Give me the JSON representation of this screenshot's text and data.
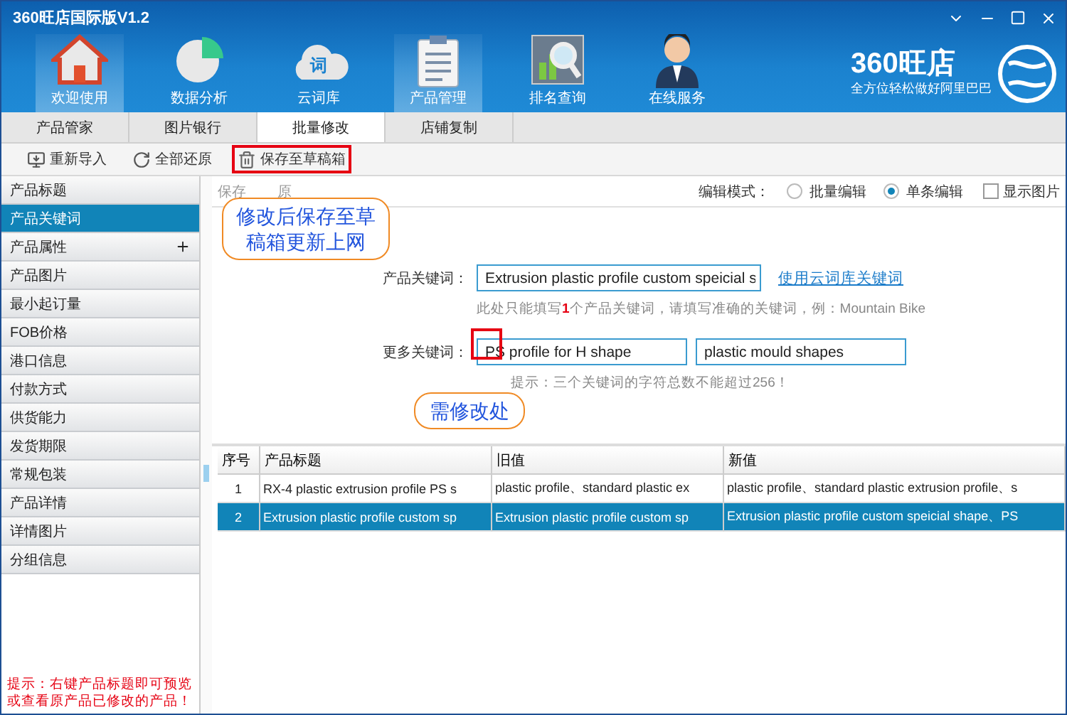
{
  "window": {
    "title": "360旺店国际版V1.2"
  },
  "nav": [
    {
      "label": "欢迎使用",
      "selected": true
    },
    {
      "label": "数据分析",
      "selected": false
    },
    {
      "label": "云词库",
      "badge": "词",
      "selected": false
    },
    {
      "label": "产品管理",
      "selected": true
    },
    {
      "label": "排名查询",
      "selected": false
    },
    {
      "label": "在线服务",
      "selected": false
    }
  ],
  "logo": {
    "name": "360旺店",
    "slogan": "全方位轻松做好阿里巴巴"
  },
  "subtabs": [
    {
      "label": "产品管家",
      "selected": false
    },
    {
      "label": "图片银行",
      "selected": false
    },
    {
      "label": "批量修改",
      "selected": true
    },
    {
      "label": "店铺复制",
      "selected": false
    }
  ],
  "toolbar": [
    {
      "label": "重新导入",
      "highlighted": false
    },
    {
      "label": "全部还原",
      "highlighted": false
    },
    {
      "label": "保存至草稿箱",
      "highlighted": true
    }
  ],
  "sidebar": {
    "items": [
      {
        "label": "产品标题",
        "selected": false,
        "expandable": false
      },
      {
        "label": "产品关键词",
        "selected": true,
        "expandable": false
      },
      {
        "label": "产品属性",
        "selected": false,
        "expandable": true
      },
      {
        "label": "产品图片",
        "selected": false,
        "expandable": false
      },
      {
        "label": "最小起订量",
        "selected": false,
        "expandable": false
      },
      {
        "label": "FOB价格",
        "selected": false,
        "expandable": false
      },
      {
        "label": "港口信息",
        "selected": false,
        "expandable": false
      },
      {
        "label": "付款方式",
        "selected": false,
        "expandable": false
      },
      {
        "label": "供货能力",
        "selected": false,
        "expandable": false
      },
      {
        "label": "发货期限",
        "selected": false,
        "expandable": false
      },
      {
        "label": "常规包装",
        "selected": false,
        "expandable": false
      },
      {
        "label": "产品详情",
        "selected": false,
        "expandable": false
      },
      {
        "label": "详情图片",
        "selected": false,
        "expandable": false
      },
      {
        "label": "分组信息",
        "selected": false,
        "expandable": false
      }
    ],
    "tip": "提示：右键产品标题即可预览或查看原产品已修改的产品！"
  },
  "actions": [
    "保存",
    "原"
  ],
  "edit_mode": {
    "label": "编辑模式：",
    "options": [
      {
        "label": "批量编辑",
        "selected": false
      },
      {
        "label": "单条编辑",
        "selected": true
      }
    ],
    "show_images": {
      "label": "显示图片",
      "checked": false
    }
  },
  "keyword": {
    "label": "产品关键词：",
    "value": "Extrusion plastic profile custom speicial s",
    "link": "使用云词库关键词",
    "hint": "此处只能填写**1**个产品关键词，请填写准确的关键词，例：Mountain Bike"
  },
  "more_keywords": {
    "label": "更多关键词：",
    "values": [
      "PS profile for H shape",
      "plastic mould shapes"
    ],
    "hint": "提示：三个关键词的字符总数不能超过256！"
  },
  "callouts": [
    {
      "text": "修改后保存至草稿箱更新上网"
    },
    {
      "text": "需修改处"
    }
  ],
  "table": {
    "columns": [
      "序号",
      "产品标题",
      "旧值",
      "新值"
    ],
    "rows": [
      {
        "cells": [
          "1",
          "RX-4 plastic extrusion profile PS s",
          "plastic profile、standard plastic ex",
          "plastic profile、standard plastic extrusion profile、s"
        ],
        "selected": false
      },
      {
        "cells": [
          "2",
          "Extrusion plastic profile custom sp",
          "Extrusion plastic profile custom sp",
          "Extrusion plastic profile custom speicial shape、PS"
        ],
        "selected": true
      }
    ]
  }
}
